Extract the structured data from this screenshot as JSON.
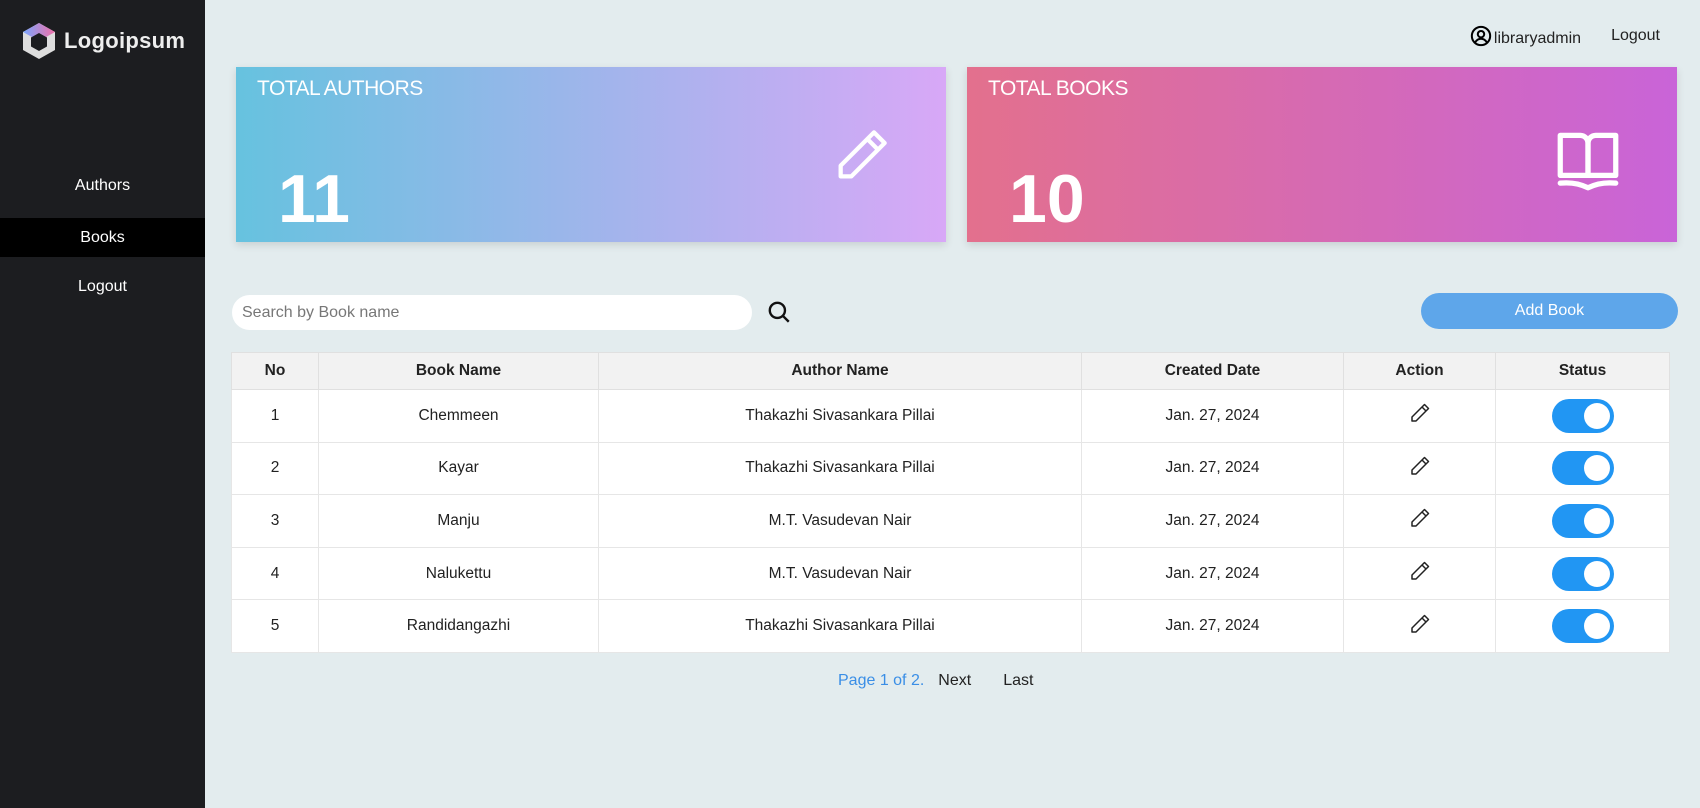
{
  "brand": {
    "name": "Logoipsum"
  },
  "sidebar": {
    "items": [
      {
        "label": "Authors"
      },
      {
        "label": "Books",
        "active": true
      },
      {
        "label": "Logout"
      }
    ]
  },
  "topbar": {
    "username": "libraryadmin",
    "logout": "Logout"
  },
  "cards": [
    {
      "title": "TOTAL AUTHORS",
      "value": "11",
      "icon": "pencil-icon"
    },
    {
      "title": "TOTAL BOOKS",
      "value": "10",
      "icon": "book-open-icon"
    }
  ],
  "search": {
    "placeholder": "Search by Book name",
    "value": ""
  },
  "add_button": "Add Book",
  "table": {
    "headers": [
      "No",
      "Book Name",
      "Author Name",
      "Created Date",
      "Action",
      "Status"
    ],
    "rows": [
      {
        "no": "1",
        "book": "Chemmeen",
        "author": "Thakazhi Sivasankara Pillai",
        "date": "Jan. 27, 2024",
        "status": true
      },
      {
        "no": "2",
        "book": "Kayar",
        "author": "Thakazhi Sivasankara Pillai",
        "date": "Jan. 27, 2024",
        "status": true
      },
      {
        "no": "3",
        "book": "Manju",
        "author": "M.T. Vasudevan Nair",
        "date": "Jan. 27, 2024",
        "status": true
      },
      {
        "no": "4",
        "book": "Nalukettu",
        "author": "M.T. Vasudevan Nair",
        "date": "Jan. 27, 2024",
        "status": true
      },
      {
        "no": "5",
        "book": "Randidangazhi",
        "author": "Thakazhi Sivasankara Pillai",
        "date": "Jan. 27, 2024",
        "status": true
      }
    ]
  },
  "pagination": {
    "current": "Page 1 of 2.",
    "next": "Next",
    "last": "Last"
  },
  "colors": {
    "sidebar": "#1c1d20",
    "accent": "#2196f3",
    "add_button": "#5ea6ea",
    "page_bg": "#e3ecee"
  }
}
